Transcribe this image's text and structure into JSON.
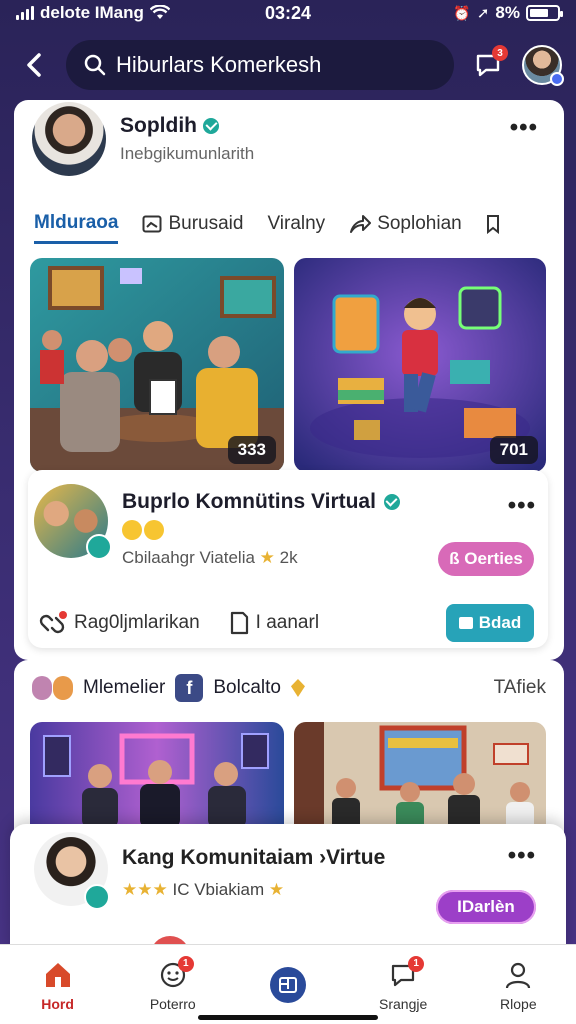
{
  "status_bar": {
    "carrier": "delote IMang",
    "time": "03:24",
    "battery_text": "8%"
  },
  "search": {
    "value": "Hiburlars Komerkesh"
  },
  "header": {
    "message_badge": "3"
  },
  "profile": {
    "name": "Sopldih",
    "subtitle": "Inebgikumunlarith"
  },
  "tabs": [
    {
      "label": "Mlduraoa"
    },
    {
      "label": "Burusaid"
    },
    {
      "label": "Viralny"
    },
    {
      "label": "Soplohian"
    }
  ],
  "tiles": [
    {
      "count": "333"
    },
    {
      "count": "701"
    }
  ],
  "group": {
    "title": "Buprlo Komnütins Virtual",
    "meta": "Cbilaahgr Viatelia",
    "meta_count": "2k",
    "pill_label": "ß Oerties",
    "action_1": "Rag0ljmlarikan",
    "action_2": "I aanarl",
    "bold_button": "Bdad"
  },
  "feed": {
    "label_1": "Mlemelier",
    "label_2": "Bolcalto",
    "right": "TAfiek"
  },
  "overlay": {
    "title": "Kang Komunitaiam ›Virtue",
    "stars": "★★★",
    "meta": "IC Vbiakiam",
    "star_end": "★",
    "pill_label": "IDarlèn"
  },
  "bottom_nav": [
    {
      "label": "Hord"
    },
    {
      "label": "Poterro",
      "badge": "1"
    },
    {
      "label": ""
    },
    {
      "label": "Srangje",
      "badge": "1"
    },
    {
      "label": "Rlope"
    }
  ],
  "colors": {
    "accent_blue": "#1a5fa8",
    "teal": "#1fa89a",
    "pink_pill": "#d86ab8",
    "purple_pill": "#9c3fc8",
    "home_red": "#c62828"
  }
}
